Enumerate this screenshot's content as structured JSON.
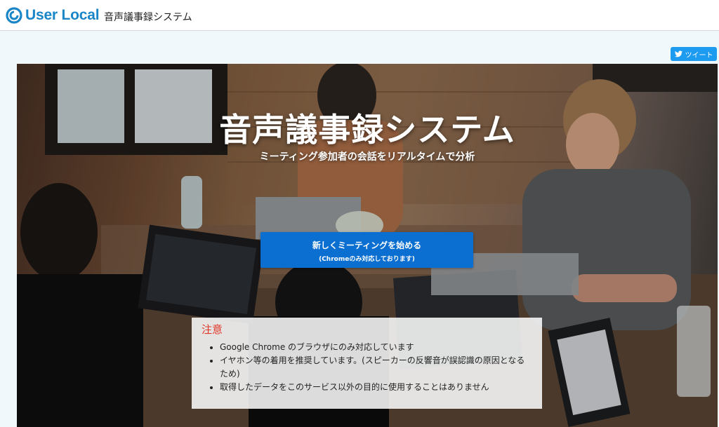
{
  "header": {
    "logo_text": "User Local",
    "system_name": "音声議事録システム",
    "logo_icon": "user-local-logo-icon"
  },
  "tweet": {
    "label": "ツイート",
    "icon": "twitter-bird-icon",
    "color": "#1d9bf0"
  },
  "hero": {
    "title": "音声議事録システム",
    "subtitle": "ミーティング参加者の会話をリアルタイムで分析"
  },
  "start_button": {
    "label": "新しくミーティングを始める",
    "note": "(Chromeのみ対応しております)",
    "color": "#0a6fd0"
  },
  "notice": {
    "title": "注意",
    "title_color": "#e03426",
    "items": [
      "Google Chrome のブラウザにのみ対応しています",
      "イヤホン等の着用を推奨しています。(スピーカーの反響音が誤認識の原因となるため)",
      "取得したデータをこのサービス以外の目的に使用することはありません"
    ]
  },
  "colors": {
    "brand": "#1a86c8",
    "page_background": "#f1f8fb"
  }
}
